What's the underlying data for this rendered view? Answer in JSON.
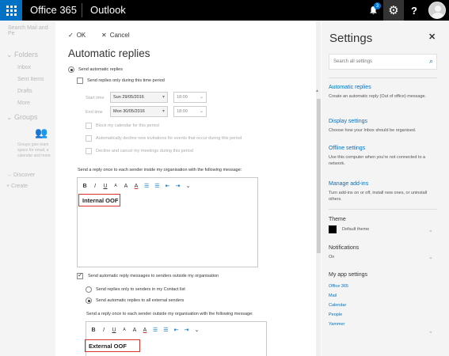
{
  "topbar": {
    "app_suite": "Office 365",
    "app_name": "Outlook",
    "notification_count": "3",
    "help_label": "?"
  },
  "leftnav": {
    "search_placeholder": "Search Mail and Pe",
    "folders_label": "Folders",
    "items": [
      "Inbox",
      "Sent Items",
      "Drafts",
      "More"
    ],
    "groups_label": "Groups",
    "groups_text": "Groups give team space for email, a calendar and more",
    "discover_label": "Discover",
    "create_label": "Create"
  },
  "panel": {
    "ok_label": "OK",
    "cancel_label": "Cancel",
    "title": "Automatic replies",
    "send_auto_replies": "Send automatic replies",
    "time_period_label": "Send replies only during this time period",
    "start_time_label": "Start time",
    "start_date": "Sun 29/05/2016",
    "start_time": "18:00",
    "end_time_label": "End time",
    "end_date": "Mon 30/05/2016",
    "end_time": "18:00",
    "block_calendar": "Block my calendar for this period",
    "decline_invites": "Automatically decline new invitations for events that occur during this period",
    "decline_cancel": "Decline and cancel my meetings during this period",
    "inside_prompt": "Send a reply once to each sender inside my organisation with the following message:",
    "internal_message": "Internal OOF",
    "outside_toggle": "Send automatic reply messages to senders outside my organisation",
    "contacts_only": "Send replies only to senders in my Contact list",
    "all_external": "Send automatic replies to all external senders",
    "outside_prompt": "Send a reply once to each sender outside my organisation with the following message:",
    "external_message": "External OOF",
    "toolbar": [
      "B",
      "I",
      "U",
      "A",
      "A",
      "A",
      "☰",
      "☰",
      "⇤",
      "⇥",
      "⌄"
    ]
  },
  "settings": {
    "title": "Settings",
    "search_placeholder": "Search all settings",
    "items": [
      {
        "title": "Automatic replies",
        "desc": "Create an automatic reply (Out of office) message."
      },
      {
        "title": "Display settings",
        "desc": "Choose how your Inbox should be organised."
      },
      {
        "title": "Offline settings",
        "desc": "Use this computer when you're not connected to a network."
      },
      {
        "title": "Manage add-ins",
        "desc": "Turn add-ins on or off, install new ones, or uninstall others."
      }
    ],
    "theme_label": "Theme",
    "theme_value": "Default theme",
    "notifications_label": "Notifications",
    "notifications_value": "On",
    "my_app_settings": "My app settings",
    "app_links": [
      "Office 365",
      "Mail",
      "Calendar",
      "People",
      "Yammer"
    ]
  },
  "colors": {
    "accent": "#0072c6",
    "highlight_box": "#d9312b",
    "topbar": "#000000"
  }
}
